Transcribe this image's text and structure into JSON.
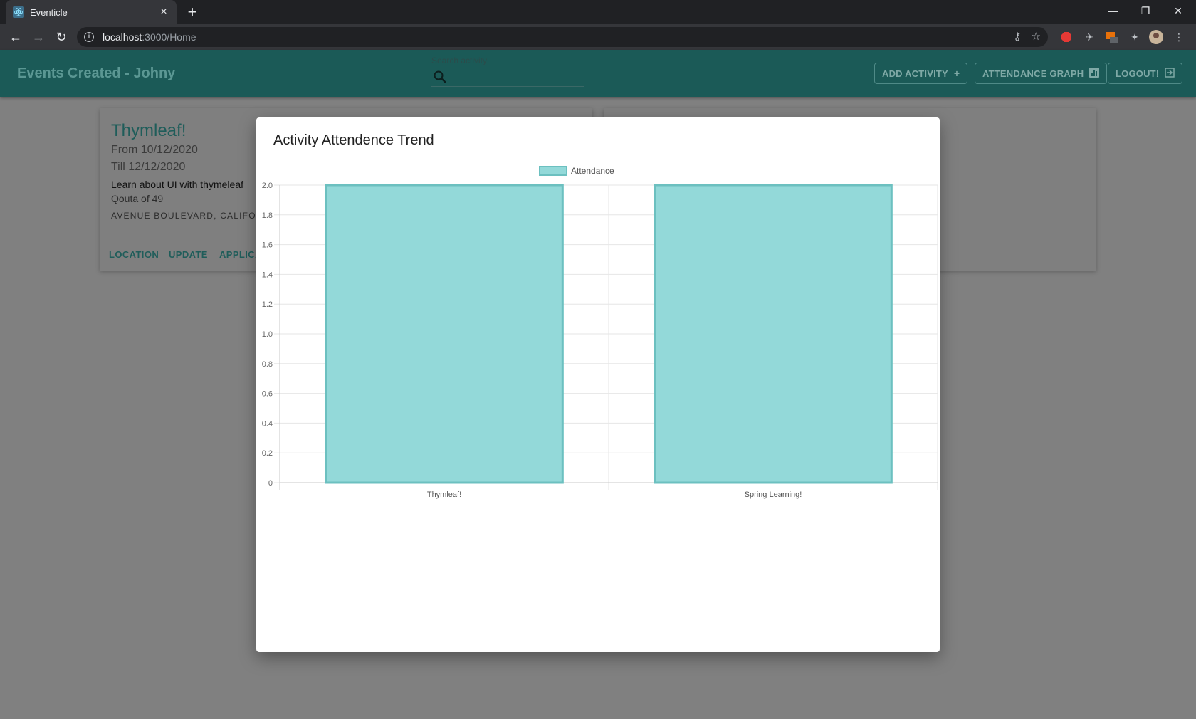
{
  "browser": {
    "tab_title": "Eventicle",
    "url_host": "localhost",
    "url_path": ":3000/Home",
    "new_tab_label": "+",
    "close_tab_label": "×"
  },
  "header": {
    "title": "Events Created - Johny",
    "search": {
      "label": "Search activity",
      "value": ""
    },
    "buttons": {
      "add_activity": "ADD ACTIVITY",
      "attendance_graph": "ATTENDANCE GRAPH",
      "logout": "LOGOUT!"
    }
  },
  "cards": [
    {
      "title": "Thymleaf!",
      "from": "From 10/12/2020",
      "till": "Till 12/12/2020",
      "description": "Learn about UI with thymeleaf",
      "quota": "Qouta of 49",
      "address": "AVENUE BOULEVARD, CALIFORNI",
      "actions": {
        "location": "LOCATION",
        "update": "UPDATE",
        "applicants": "APPLICA"
      }
    }
  ],
  "modal": {
    "title": "Activity Attendence Trend"
  },
  "chart_data": {
    "type": "bar",
    "categories": [
      "Thymleaf!",
      "Spring Learning!"
    ],
    "series": [
      {
        "name": "Attendance",
        "values": [
          2,
          2
        ]
      }
    ],
    "ylim": [
      0,
      2
    ],
    "yticks": [
      "0",
      "0.2",
      "0.4",
      "0.6",
      "0.8",
      "1.0",
      "1.2",
      "1.4",
      "1.6",
      "1.8",
      "2.0"
    ],
    "legend_position": "top",
    "grid": true,
    "colors": {
      "bar_fill": "#93d9d9",
      "bar_stroke": "#6cc0c0"
    }
  }
}
